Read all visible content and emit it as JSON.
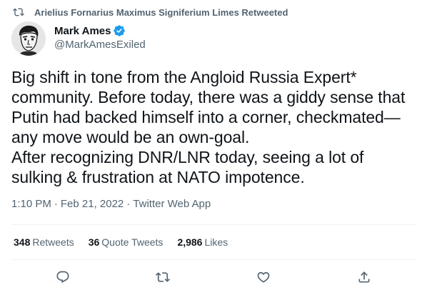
{
  "retweet_bar": {
    "icon": "retweet-icon",
    "text": "Arielius Fornarius Maximus Signiferium Limes Retweeted"
  },
  "author": {
    "display_name": "Mark Ames",
    "handle": "@MarkAmesExiled",
    "verified_icon": "verified-badge-icon",
    "verified_color": "#1d9bf0"
  },
  "tweet": {
    "lines": [
      "Big shift in tone from the Angloid Russia Expert*",
      "community. Before today, there was a giddy sense that",
      "Putin had backed himself into a corner, checkmated—",
      "any move would be an own-goal.",
      "After recognizing DNR/LNR today, seeing a lot of",
      "sulking & frustration at NATO impotence."
    ]
  },
  "meta": {
    "time": "1:10 PM",
    "separator": "·",
    "date": "Feb 21, 2022",
    "source": "Twitter Web App"
  },
  "stats": {
    "retweets_count": "348",
    "retweets_label": "Retweets",
    "quotes_count": "36",
    "quotes_label": "Quote Tweets",
    "likes_count": "2,986",
    "likes_label": "Likes"
  },
  "actions": {
    "reply_icon": "reply-icon",
    "retweet_icon": "retweet-icon",
    "like_icon": "heart-icon",
    "share_icon": "share-icon",
    "icon_color": "#536471"
  }
}
